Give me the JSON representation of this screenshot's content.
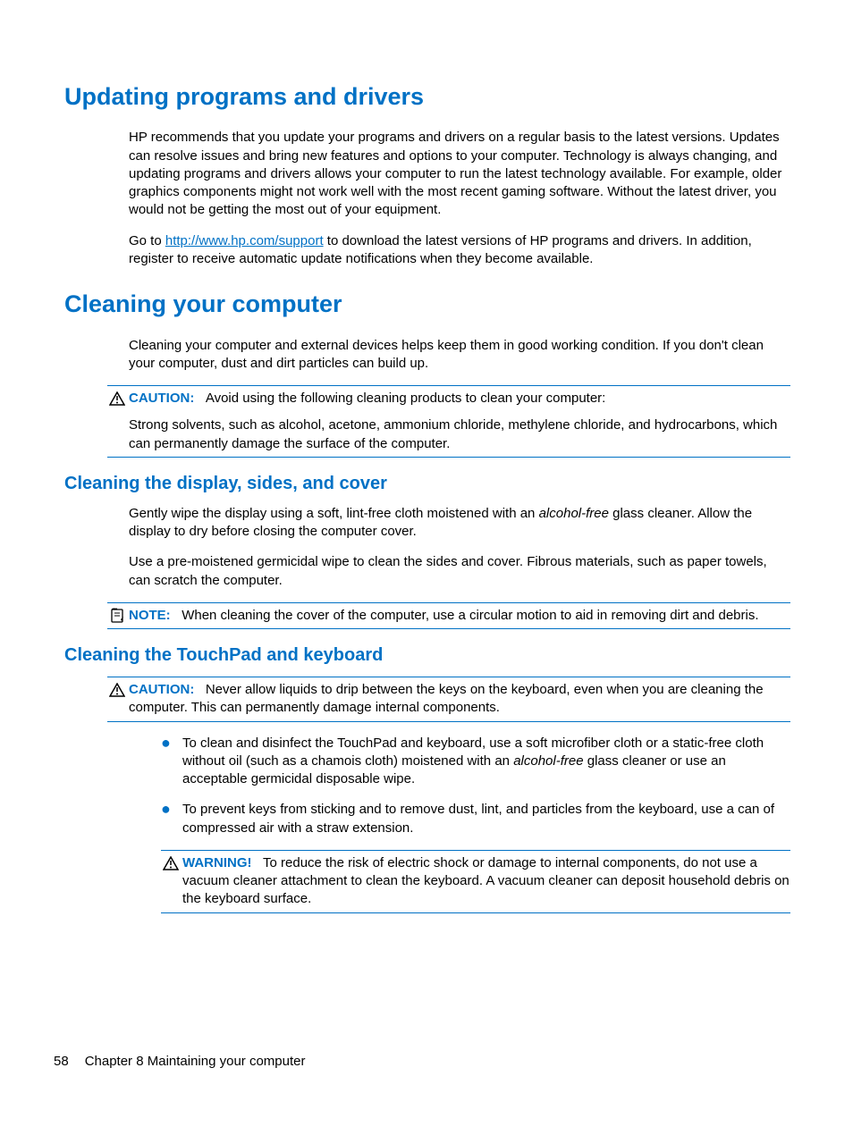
{
  "sections": {
    "updating": {
      "heading": "Updating programs and drivers",
      "p1": "HP recommends that you update your programs and drivers on a regular basis to the latest versions. Updates can resolve issues and bring new features and options to your computer. Technology is always changing, and updating programs and drivers allows your computer to run the latest technology available. For example, older graphics components might not work well with the most recent gaming software. Without the latest driver, you would not be getting the most out of your equipment.",
      "p2_pre": "Go to ",
      "p2_link": "http://www.hp.com/support",
      "p2_post": " to download the latest versions of HP programs and drivers. In addition, register to receive automatic update notifications when they become available."
    },
    "cleaning": {
      "heading": "Cleaning your computer",
      "p1": "Cleaning your computer and external devices helps keep them in good working condition. If you don't clean your computer, dust and dirt particles can build up.",
      "caution": {
        "label": "CAUTION:",
        "line1": "Avoid using the following cleaning products to clean your computer:",
        "line2": "Strong solvents, such as alcohol, acetone, ammonium chloride, methylene chloride, and hydrocarbons, which can permanently damage the surface of the computer."
      }
    },
    "display": {
      "heading": "Cleaning the display, sides, and cover",
      "p1_a": "Gently wipe the display using a soft, lint-free cloth moistened with an ",
      "p1_i": "alcohol-free",
      "p1_b": " glass cleaner. Allow the display to dry before closing the computer cover.",
      "p2": "Use a pre-moistened germicidal wipe to clean the sides and cover. Fibrous materials, such as paper towels, can scratch the computer.",
      "note": {
        "label": "NOTE:",
        "text": "When cleaning the cover of the computer, use a circular motion to aid in removing dirt and debris."
      }
    },
    "touchpad": {
      "heading": "Cleaning the TouchPad and keyboard",
      "caution": {
        "label": "CAUTION:",
        "text": "Never allow liquids to drip between the keys on the keyboard, even when you are cleaning the computer. This can permanently damage internal components."
      },
      "bullets": {
        "b1_a": "To clean and disinfect the TouchPad and keyboard, use a soft microfiber cloth or a static-free cloth without oil (such as a chamois cloth) moistened with an ",
        "b1_i": "alcohol-free",
        "b1_b": " glass cleaner or use an acceptable germicidal disposable wipe.",
        "b2": "To prevent keys from sticking and to remove dust, lint, and particles from the keyboard, use a can of compressed air with a straw extension."
      },
      "warning": {
        "label": "WARNING!",
        "text": "To reduce the risk of electric shock or damage to internal components, do not use a vacuum cleaner attachment to clean the keyboard. A vacuum cleaner can deposit household debris on the keyboard surface."
      }
    }
  },
  "footer": {
    "page": "58",
    "chapter": "Chapter 8   Maintaining your computer"
  }
}
